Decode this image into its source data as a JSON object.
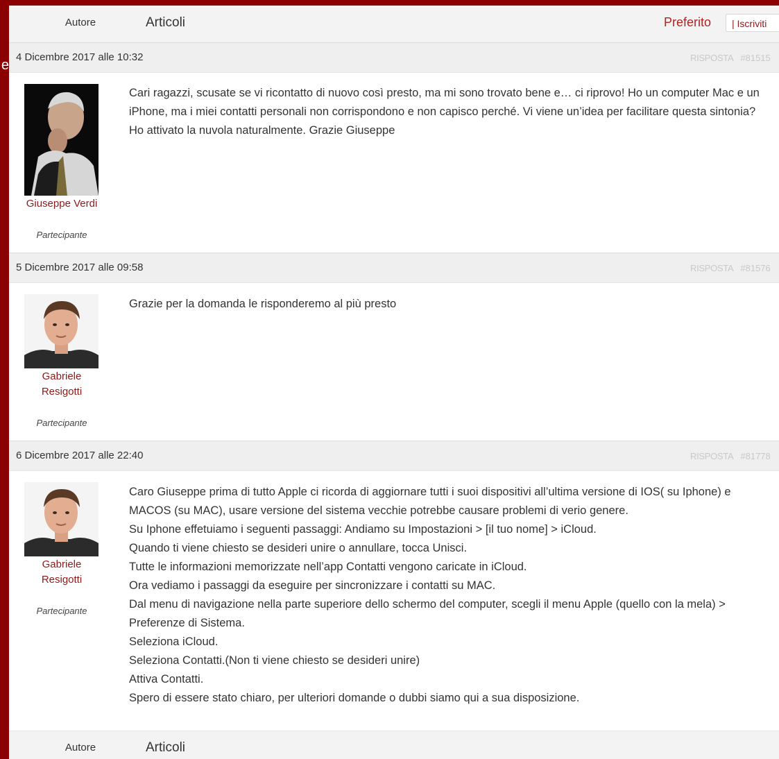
{
  "header": {
    "author_col": "Autore",
    "articles_col": "Articoli",
    "favorite": "Preferito",
    "subscribe": "| Iscriviti"
  },
  "edge": {
    "glyph": "e"
  },
  "posts": [
    {
      "date": "4 Dicembre 2017 alle 10:32",
      "reply": "RISPOSTA",
      "id": "#81515",
      "author": "Giuseppe Verdi",
      "role": "Partecipante",
      "body": [
        "Cari ragazzi, scusate se vi ricontatto di nuovo così presto, ma mi sono trovato bene e… ci riprovo! Ho un computer Mac e un iPhone, ma i miei contatti personali non corrispondono e non capisco perché. Vi viene un’idea per facilitare questa sintonia? Ho attivato la nuvola naturalmente. Grazie Giuseppe"
      ]
    },
    {
      "date": "5 Dicembre 2017 alle 09:58",
      "reply": "RISPOSTA",
      "id": "#81576",
      "author_line1": "Gabriele",
      "author_line2": "Resigotti",
      "role": "Partecipante",
      "body": [
        "Grazie per la domanda le risponderemo al più presto"
      ]
    },
    {
      "date": "6 Dicembre 2017 alle 22:40",
      "reply": "RISPOSTA",
      "id": "#81778",
      "author_line1": "Gabriele",
      "author_line2": "Resigotti",
      "role": "Partecipante",
      "body": [
        "Caro Giuseppe prima di tutto Apple ci ricorda di aggiornare tutti i suoi dispositivi all’ultima versione di IOS( su Iphone) e MACOS (su MAC), usare versione del sistema vecchie potrebbe causare problemi di verio genere.",
        "Su Iphone effetuiamo i seguenti passaggi: Andiamo su Impostazioni > [il tuo nome] > iCloud.",
        "Quando ti viene chiesto se desideri unire o annullare, tocca Unisci.",
        "Tutte le informazioni memorizzate nell’app Contatti vengono caricate in iCloud.",
        "Ora vediamo i passaggi da eseguire per sincronizzare i contatti su MAC.",
        "Dal menu di navigazione nella parte superiore dello schermo del computer, scegli il menu Apple (quello con la mela) > Preferenze di Sistema.",
        "Seleziona iCloud.",
        "Seleziona Contatti.(Non ti viene chiesto se desideri unire)",
        "Attiva Contatti.",
        "Spero di essere stato chiaro, per ulteriori domande o dubbi siamo qui a sua disposizione."
      ]
    }
  ],
  "footer": {
    "author_col": "Autore",
    "articles_col": "Articoli"
  }
}
